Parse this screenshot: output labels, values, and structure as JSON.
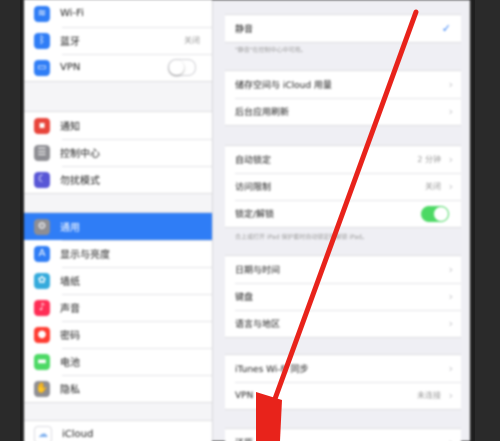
{
  "sidebar": {
    "group1": [
      {
        "name": "wifi",
        "label": "Wi-Fi",
        "value": "",
        "icon": "wifi-icon",
        "color": "#2f7df6",
        "glyph": "≋"
      },
      {
        "name": "bluetooth",
        "label": "蓝牙",
        "value": "关闭",
        "icon": "bluetooth-icon",
        "color": "#2f7df6",
        "glyph": "ᛒ"
      },
      {
        "name": "vpn",
        "label": "VPN",
        "value": "",
        "icon": "vpn-icon",
        "color": "#2f7df6",
        "glyph": "▭",
        "toggle": "off"
      }
    ],
    "group2": [
      {
        "name": "notifications",
        "label": "通知",
        "icon": "notifications-icon",
        "color": "#e8443a",
        "glyph": "▪"
      },
      {
        "name": "control-center",
        "label": "控制中心",
        "icon": "control-center-icon",
        "color": "#8e8e93",
        "glyph": "☰"
      },
      {
        "name": "do-not-disturb",
        "label": "勿扰模式",
        "icon": "moon-icon",
        "color": "#5856d6",
        "glyph": "☾"
      }
    ],
    "group3": [
      {
        "name": "general",
        "label": "通用",
        "icon": "gear-icon",
        "color": "#8e8e93",
        "glyph": "⚙",
        "selected": true
      },
      {
        "name": "display",
        "label": "显示与亮度",
        "icon": "display-icon",
        "color": "#2f7df6",
        "glyph": "A"
      },
      {
        "name": "wallpaper",
        "label": "墙纸",
        "icon": "wallpaper-icon",
        "color": "#34aadc",
        "glyph": "✿"
      },
      {
        "name": "sounds",
        "label": "声音",
        "icon": "sound-icon",
        "color": "#ff2d55",
        "glyph": "♪"
      },
      {
        "name": "passcode",
        "label": "密码",
        "icon": "lock-icon",
        "color": "#ff3b30",
        "glyph": "●"
      },
      {
        "name": "battery",
        "label": "电池",
        "icon": "battery-icon",
        "color": "#4cd964",
        "glyph": "▬"
      },
      {
        "name": "privacy",
        "label": "隐私",
        "icon": "hand-icon",
        "color": "#8e8e93",
        "glyph": "✋"
      }
    ],
    "group4": [
      {
        "name": "icloud",
        "label": "iCloud",
        "icon": "icloud-icon",
        "color": "#ffffff",
        "glyph": "☁"
      }
    ]
  },
  "detail": {
    "group1": [
      {
        "name": "mute",
        "label": "静音",
        "check": true
      }
    ],
    "note1": "\"静音\"在控制中心中可用。",
    "group2": [
      {
        "name": "storage",
        "label": "储存空间与 iCloud 用量"
      },
      {
        "name": "background-refresh",
        "label": "后台应用刷新"
      }
    ],
    "group3": [
      {
        "name": "auto-lock",
        "label": "自动锁定",
        "value": "2 分钟"
      },
      {
        "name": "restrictions",
        "label": "访问限制",
        "value": "关闭"
      },
      {
        "name": "lock-unlock",
        "label": "锁定/解锁",
        "toggle": "on"
      }
    ],
    "note2": "合上或打开 iPad 保护套时自动锁定和解锁 iPad。",
    "group4": [
      {
        "name": "date-time",
        "label": "日期与时间"
      },
      {
        "name": "keyboard",
        "label": "键盘"
      },
      {
        "name": "language-region",
        "label": "语言与地区"
      }
    ],
    "group5": [
      {
        "name": "itunes-wifi-sync",
        "label": "iTunes Wi-Fi 同步"
      },
      {
        "name": "vpn",
        "label": "VPN",
        "value": "未连接"
      }
    ],
    "group6": [
      {
        "name": "reset",
        "label": "还原"
      }
    ]
  },
  "colors": {
    "accent": "#2f7df6",
    "toggle_on": "#4cd964",
    "arrow": "#e8231b"
  }
}
